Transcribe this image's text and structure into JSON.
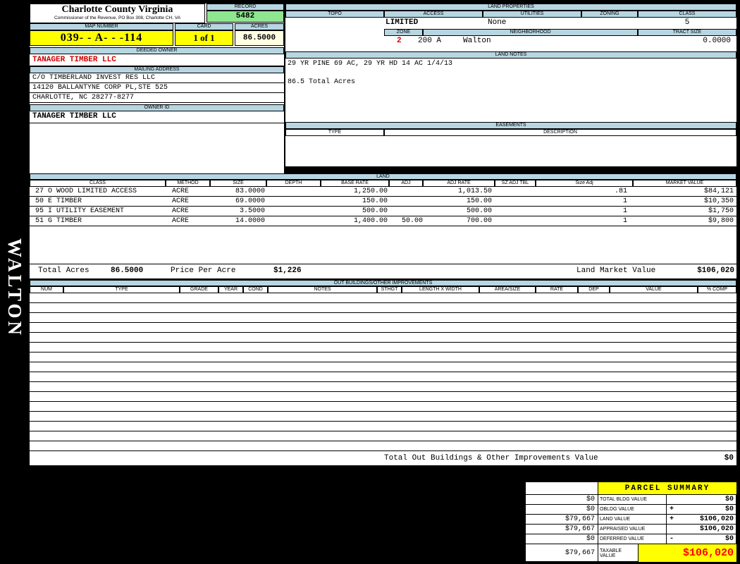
{
  "colors": {
    "header_blue": "#b7d6e2",
    "record_green": "#8ee690",
    "highlight_yellow": "#ffff00",
    "acres_cream": "#ffffe2",
    "owner_red": "#d40000",
    "taxable_red": "#ff0000"
  },
  "sidebar": {
    "vertical_label": "WALTON"
  },
  "header": {
    "county_name": "Charlotte County Virginia",
    "county_subtitle": "Commissioner of the Revenue, PO Box 308, Charlotte CH, VA",
    "record_label": "RECORD",
    "record_value": "5482",
    "map_number_label": "MAP NUMBER",
    "map_number_value": "039- - A- - -114",
    "card_label": "CARD",
    "card_value": "1 of 1",
    "acres_label": "ACRES",
    "acres_value": "86.5000"
  },
  "owner": {
    "deeded_owner_label": "DEEDED OWNER",
    "deeded_owner": "TANAGER TIMBER LLC",
    "mailing_label": "MAILING ADDRESS",
    "mailing_lines": [
      "C/O TIMBERLAND INVEST RES LLC",
      "14120 BALLANTYNE CORP PL,STE 525",
      "CHARLOTTE, NC 28277-8277"
    ],
    "owner_id_label": "OWNER ID",
    "owner_id": "TANAGER TIMBER LLC"
  },
  "land_properties": {
    "title": "LAND PROPERTIES",
    "columns": [
      "TOPO",
      "ACCESS",
      "UTILITIES",
      "ZONING",
      "CLASS"
    ],
    "access_value": "LIMITED",
    "utilities_value": "None",
    "class_value": "5",
    "zone_label": "ZONE",
    "zone_value": "2",
    "zone_code": "200 A",
    "neighborhood_label": "NEIGHBORHOOD",
    "neighborhood_value": "Walton",
    "tract_size_label": "TRACT SIZE",
    "tract_size_value": "0.0000"
  },
  "land_notes": {
    "title": "LAND NOTES",
    "line1": "29 YR PINE 69 AC, 29 YR HD 14 AC 1/4/13",
    "line2": "86.5 Total Acres"
  },
  "easements": {
    "title": "EASEMENTS",
    "type_label": "TYPE",
    "description_label": "DESCRIPTION"
  },
  "land_table": {
    "title": "LAND",
    "columns": [
      "CLASS",
      "METHOD",
      "SIZE",
      "DEPTH",
      "BASE RATE",
      "ADJ",
      "ADJ RATE",
      "SZ ADJ TBL",
      "Size Adj",
      "MARKET VALUE"
    ],
    "rows": [
      {
        "class": "27 O WOOD LIMITED ACCESS",
        "method": "ACRE",
        "size": "83.0000",
        "depth": "",
        "base_rate": "1,250.00",
        "adj": "",
        "adj_rate": "1,013.50",
        "sz_adj_tbl": "",
        "size_adj": ".81",
        "market_value": "$84,121"
      },
      {
        "class": "50 E TIMBER",
        "method": "ACRE",
        "size": "69.0000",
        "depth": "",
        "base_rate": "150.00",
        "adj": "",
        "adj_rate": "150.00",
        "sz_adj_tbl": "",
        "size_adj": "1",
        "market_value": "$10,350"
      },
      {
        "class": "95 I UTILITY EASEMENT",
        "method": "ACRE",
        "size": "3.5000",
        "depth": "",
        "base_rate": "500.00",
        "adj": "",
        "adj_rate": "500.00",
        "sz_adj_tbl": "",
        "size_adj": "1",
        "market_value": "$1,750"
      },
      {
        "class": "51 G TIMBER",
        "method": "ACRE",
        "size": "14.0000",
        "depth": "",
        "base_rate": "1,400.00",
        "adj": "50.00",
        "adj_rate": "700.00",
        "sz_adj_tbl": "",
        "size_adj": "1",
        "market_value": "$9,800"
      }
    ],
    "totals": {
      "total_acres_label": "Total Acres",
      "total_acres_value": "86.5000",
      "price_per_acre_label": "Price Per Acre",
      "price_per_acre_value": "$1,226",
      "land_market_value_label": "Land Market Value",
      "land_market_value": "$106,020"
    }
  },
  "out_buildings": {
    "title": "OUT BUILDINGS/OTHER IMPROVEMENTS",
    "columns": [
      "NUM",
      "TYPE",
      "GRADE",
      "YEAR",
      "COND",
      "NOTES",
      "STHGT",
      "LENGTH X WIDTH",
      "AREA/SIZE",
      "RATE",
      "DEP",
      "VALUE",
      "% COMP"
    ],
    "empty_row_count": 16,
    "total_label": "Total Out Buildings & Other Improvements Value",
    "total_value": "$0"
  },
  "parcel_summary": {
    "title": "PARCEL SUMMARY",
    "rows": [
      {
        "prior": "$0",
        "label": "TOTAL BLDG VALUE",
        "op": "",
        "value": "$0"
      },
      {
        "prior": "$0",
        "label": "OBLDG VALUE",
        "op": "+",
        "value": "$0"
      },
      {
        "prior": "$79,667",
        "label": "LAND VALUE",
        "op": "+",
        "value": "$106,020"
      },
      {
        "prior": "$79,667",
        "label": "APPRAISED VALUE",
        "op": "",
        "value": "$106,020"
      },
      {
        "prior": "$0",
        "label": "DEFERRED VALUE",
        "op": "-",
        "value": "$0"
      },
      {
        "prior": "$79,667",
        "label": "TAXABLE VALUE",
        "op": "",
        "value": "$106,020"
      }
    ]
  }
}
